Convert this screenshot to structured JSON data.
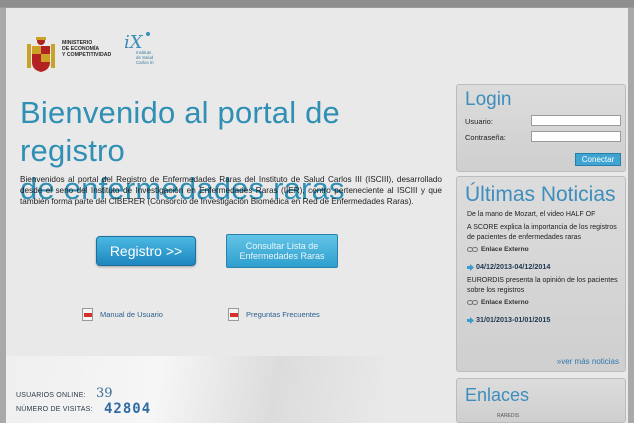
{
  "header": {
    "ministry_text": "MINISTERIO\nDE ECONOMÍA\nY COMPETITIVIDAD",
    "isciii_text": "Instituto\nde Salud\nCarlos III"
  },
  "main": {
    "title": "Bienvenido al portal de registro\nde enfermedades raras",
    "intro": "Bienvenidos al portal del Registro de Enfermedades Raras del Instituto de Salud Carlos III (ISCIII), desarrollado desde el seno del Instituto de Investigación en Enfermedades Raras (IIER), centro perteneciente al ISCIII y que también forma parte del CIBERER (Consorcio de Investigación Biomédica en Red de Enfermedades Raras).",
    "registro_button": "Registro >>",
    "consultar_button": "Consultar Lista de\nEnfermedades Raras",
    "manual_link": "Manual de Usuario",
    "faq_link": "Preguntas Frecuentes"
  },
  "stats": {
    "online_label": "USUARIOS ONLINE:",
    "online_value": "39",
    "visits_label": "NÚMERO DE VISITAS:",
    "visits_value": "42804"
  },
  "login": {
    "title": "Login",
    "user_label": "Usuario:",
    "password_label": "Contraseña:",
    "user_value": "",
    "password_value": "",
    "submit": "Conectar"
  },
  "news": {
    "title": "Últimas Noticias",
    "snippet_top": "De la mano de Mozart, el video HALF OF",
    "item1_text": "A SCORE explica la importancia de los registros de pacientes de enfermedades raras",
    "external_label": "Enlace Externo",
    "date2": "04/12/2013-04/12/2014",
    "item2_text": "EURORDIS presenta la opinión de los pacientes sobre los registros",
    "date3": "31/01/2013-01/01/2015",
    "more": "»ver más noticias"
  },
  "links": {
    "title": "Enlaces",
    "snippet": "RAREDIS"
  },
  "colors": {
    "accent_blue": "#2f8fb4",
    "button_blue": "#1d87bf",
    "panel_gray": "#d6d6d6"
  }
}
